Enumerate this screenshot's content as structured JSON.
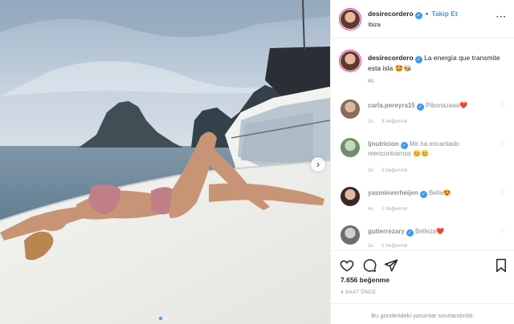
{
  "post": {
    "username": "desirecordero",
    "follow_label": "Takip Et",
    "location": "Ibiza",
    "caption": "La energía que transmite esta isla 🤩🐝",
    "caption_time": "4s",
    "likes": "7.656 beğenme",
    "time_ago": "4 SAAT ÖNCE",
    "comments_limited": "Bu gönderideki yorumlar sınırlandırıldı."
  },
  "comments": [
    {
      "user": "carla.pereyra15",
      "text": "Pibonazaaa❤️",
      "time": "3s",
      "likes": "3 beğenme"
    },
    {
      "user": "ljnutricion",
      "text": "Me ha encantado reencontrarnos 😊😊",
      "time": "3s",
      "likes": "3 beğenme"
    },
    {
      "user": "yasminverheijen",
      "text": "Bella😍",
      "time": "4s",
      "likes": "1 beğenme"
    },
    {
      "user": "gutierrezary",
      "text": "Belleza❤️",
      "time": "3s",
      "likes": "1 beğenme"
    }
  ],
  "icons": {
    "verified": "verified-badge-icon",
    "heart": "heart-icon",
    "comment": "comment-icon",
    "share": "share-icon",
    "save": "bookmark-icon",
    "more": "more-options-icon",
    "next": "chevron-right-icon"
  },
  "colors": {
    "accent": "#3897f0",
    "text": "#262626",
    "muted": "#8e8e8e"
  }
}
